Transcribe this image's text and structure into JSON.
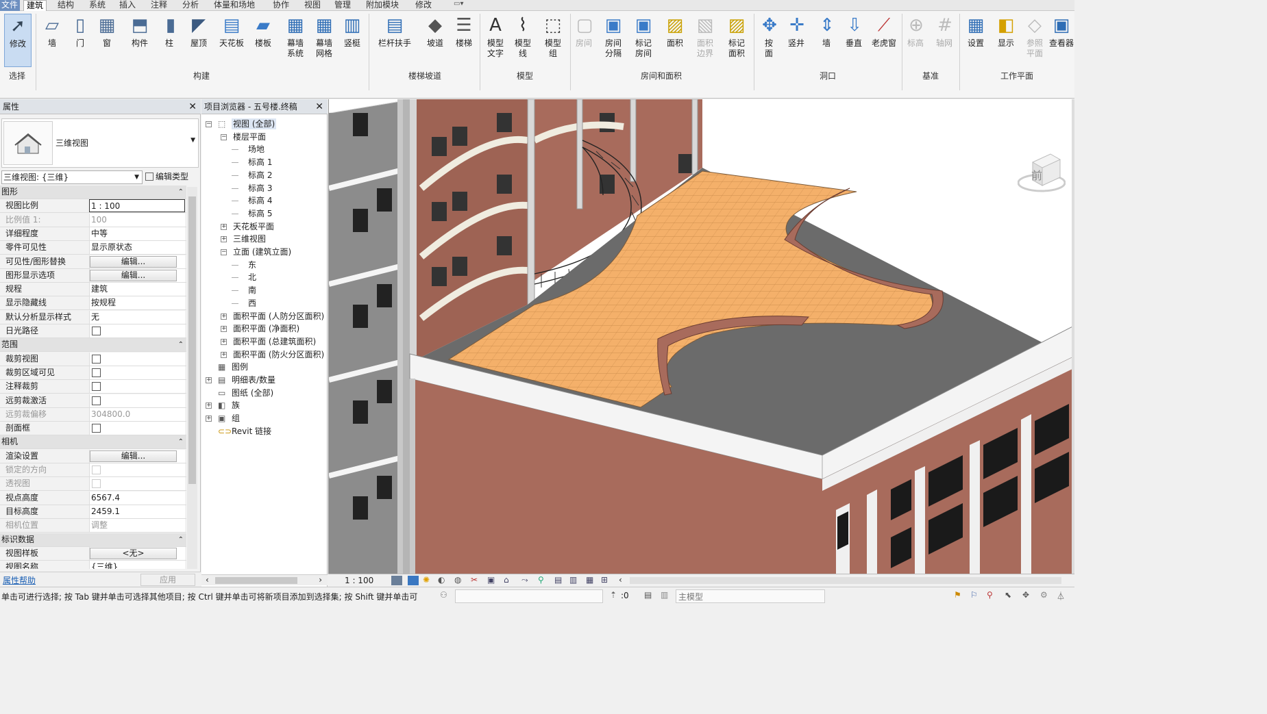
{
  "menu": {
    "tabs": [
      "文件",
      "建筑",
      "结构",
      "系统",
      "插入",
      "注释",
      "分析",
      "体量和场地",
      "协作",
      "视图",
      "管理",
      "附加模块",
      "修改"
    ],
    "active_tab": "建筑"
  },
  "ribbon": {
    "buttons": [
      {
        "label": "修改",
        "icon": "modify-cursor-icon"
      },
      {
        "label": "墙",
        "icon": "wall-icon"
      },
      {
        "label": "门",
        "icon": "door-icon"
      },
      {
        "label": "窗",
        "icon": "window-icon"
      },
      {
        "label": "构件",
        "icon": "component-icon"
      },
      {
        "label": "柱",
        "icon": "column-icon"
      },
      {
        "label": "屋顶",
        "icon": "roof-icon"
      },
      {
        "label": "天花板",
        "icon": "ceiling-icon"
      },
      {
        "label": "楼板",
        "icon": "floor-icon"
      },
      {
        "label": "幕墙\n系统",
        "icon": "curtain-system-icon"
      },
      {
        "label": "幕墙\n网格",
        "icon": "curtain-grid-icon"
      },
      {
        "label": "竖梃",
        "icon": "mullion-icon"
      },
      {
        "label": "栏杆扶手",
        "icon": "railing-icon"
      },
      {
        "label": "坡道",
        "icon": "ramp-icon"
      },
      {
        "label": "楼梯",
        "icon": "stair-icon"
      },
      {
        "label": "模型\n文字",
        "icon": "model-text-icon"
      },
      {
        "label": "模型\n线",
        "icon": "model-line-icon"
      },
      {
        "label": "模型\n组",
        "icon": "model-group-icon"
      },
      {
        "label": "房间",
        "icon": "room-icon"
      },
      {
        "label": "房间\n分隔",
        "icon": "room-separator-icon"
      },
      {
        "label": "标记\n房间",
        "icon": "tag-room-icon"
      },
      {
        "label": "面积",
        "icon": "area-icon"
      },
      {
        "label": "面积\n边界",
        "icon": "area-boundary-icon"
      },
      {
        "label": "标记\n面积",
        "icon": "tag-area-icon"
      },
      {
        "label": "按\n面",
        "icon": "by-face-icon"
      },
      {
        "label": "竖井",
        "icon": "shaft-icon"
      },
      {
        "label": "墙",
        "icon": "wall-opening-icon"
      },
      {
        "label": "垂直",
        "icon": "vertical-opening-icon"
      },
      {
        "label": "老虎窗",
        "icon": "dormer-icon"
      },
      {
        "label": "标高",
        "icon": "level-icon"
      },
      {
        "label": "轴网",
        "icon": "grid-icon"
      },
      {
        "label": "设置",
        "icon": "set-workplane-icon"
      },
      {
        "label": "显示",
        "icon": "show-workplane-icon"
      },
      {
        "label": "参照\n平面",
        "icon": "ref-plane-icon"
      },
      {
        "label": "查看器",
        "icon": "viewer-icon"
      }
    ],
    "groups": [
      "选择",
      "构建",
      "楼梯坡道",
      "模型",
      "房间和面积",
      "洞口",
      "基准",
      "工作平面"
    ]
  },
  "properties": {
    "title": "属性",
    "type_name": "三维视图",
    "selector": "三维视图: {三维}",
    "edit_type": "编辑类型",
    "rows": [
      {
        "kind": "head",
        "key": "图形"
      },
      {
        "kind": "text",
        "key": "视图比例",
        "value": "1 : 100"
      },
      {
        "kind": "text",
        "key": "比例值 1:",
        "value": "100",
        "disabled": true
      },
      {
        "kind": "text",
        "key": "详细程度",
        "value": "中等"
      },
      {
        "kind": "text",
        "key": "零件可见性",
        "value": "显示原状态"
      },
      {
        "kind": "button",
        "key": "可见性/图形替换",
        "value": "编辑..."
      },
      {
        "kind": "button",
        "key": "图形显示选项",
        "value": "编辑..."
      },
      {
        "kind": "text",
        "key": "规程",
        "value": "建筑"
      },
      {
        "kind": "text",
        "key": "显示隐藏线",
        "value": "按规程"
      },
      {
        "kind": "text",
        "key": "默认分析显示样式",
        "value": "无"
      },
      {
        "kind": "check",
        "key": "日光路径"
      },
      {
        "kind": "head",
        "key": "范围"
      },
      {
        "kind": "check",
        "key": "裁剪视图"
      },
      {
        "kind": "check",
        "key": "裁剪区域可见"
      },
      {
        "kind": "check",
        "key": "注释裁剪"
      },
      {
        "kind": "check",
        "key": "远剪裁激活"
      },
      {
        "kind": "text",
        "key": "远剪裁偏移",
        "value": "304800.0",
        "disabled": true
      },
      {
        "kind": "check",
        "key": "剖面框"
      },
      {
        "kind": "head",
        "key": "相机"
      },
      {
        "kind": "button",
        "key": "渲染设置",
        "value": "编辑..."
      },
      {
        "kind": "check",
        "key": "锁定的方向",
        "disabled": true
      },
      {
        "kind": "check",
        "key": "透视图",
        "disabled": true
      },
      {
        "kind": "text",
        "key": "视点高度",
        "value": "6567.4"
      },
      {
        "kind": "text",
        "key": "目标高度",
        "value": "2459.1"
      },
      {
        "kind": "text",
        "key": "相机位置",
        "value": "调整",
        "disabled": true
      },
      {
        "kind": "head",
        "key": "标识数据"
      },
      {
        "kind": "button",
        "key": "视图样板",
        "value": "<无>"
      },
      {
        "kind": "text",
        "key": "视图名称",
        "value": "{三维}"
      }
    ],
    "help_link": "属性帮助",
    "apply": "应用"
  },
  "browser": {
    "title": "项目浏览器 - 五号楼.终稿",
    "nodes": [
      {
        "level": 0,
        "toggle": "−",
        "icon": "views-icon",
        "label": "视图 (全部)",
        "selected": true
      },
      {
        "level": 1,
        "toggle": "−",
        "label": "楼层平面"
      },
      {
        "level": 2,
        "label": "场地"
      },
      {
        "level": 2,
        "label": "标高 1"
      },
      {
        "level": 2,
        "label": "标高 2"
      },
      {
        "level": 2,
        "label": "标高 3"
      },
      {
        "level": 2,
        "label": "标高 4"
      },
      {
        "level": 2,
        "label": "标高 5"
      },
      {
        "level": 1,
        "toggle": "+",
        "label": "天花板平面"
      },
      {
        "level": 1,
        "toggle": "+",
        "label": "三维视图"
      },
      {
        "level": 1,
        "toggle": "−",
        "label": "立面 (建筑立面)"
      },
      {
        "level": 2,
        "label": "东"
      },
      {
        "level": 2,
        "label": "北"
      },
      {
        "level": 2,
        "label": "南"
      },
      {
        "level": 2,
        "label": "西"
      },
      {
        "level": 1,
        "toggle": "+",
        "label": "面积平面 (人防分区面积)"
      },
      {
        "level": 1,
        "toggle": "+",
        "label": "面积平面 (净面积)"
      },
      {
        "level": 1,
        "toggle": "+",
        "label": "面积平面 (总建筑面积)"
      },
      {
        "level": 1,
        "toggle": "+",
        "label": "面积平面 (防火分区面积)"
      },
      {
        "level": 0,
        "icon": "legend-icon",
        "label": "图例"
      },
      {
        "level": 0,
        "toggle": "+",
        "icon": "schedule-icon",
        "label": "明细表/数量"
      },
      {
        "level": 0,
        "icon": "sheet-icon",
        "label": "图纸 (全部)"
      },
      {
        "level": 0,
        "toggle": "+",
        "icon": "family-icon",
        "label": "族"
      },
      {
        "level": 0,
        "toggle": "+",
        "icon": "group-icon",
        "label": "组"
      },
      {
        "level": 0,
        "icon": "revit-link-icon",
        "label": "Revit 链接"
      }
    ]
  },
  "viewport": {
    "viewcube_label": "前",
    "colors": {
      "brick": "#a86b5c",
      "slab": "#6b6b6b",
      "floor_tile": "#f4b06a",
      "trim": "#ffffff",
      "wall_white": "#f2f2f2"
    }
  },
  "view_control": {
    "scale": "1 : 100"
  },
  "status": {
    "hint": "单击可进行选择; 按 Tab 键并单击可选择其他项目; 按 Ctrl 键并单击可将新项目添加到选择集; 按 Shift 键并单击可",
    "selection_count": ":0",
    "model": "主模型"
  }
}
